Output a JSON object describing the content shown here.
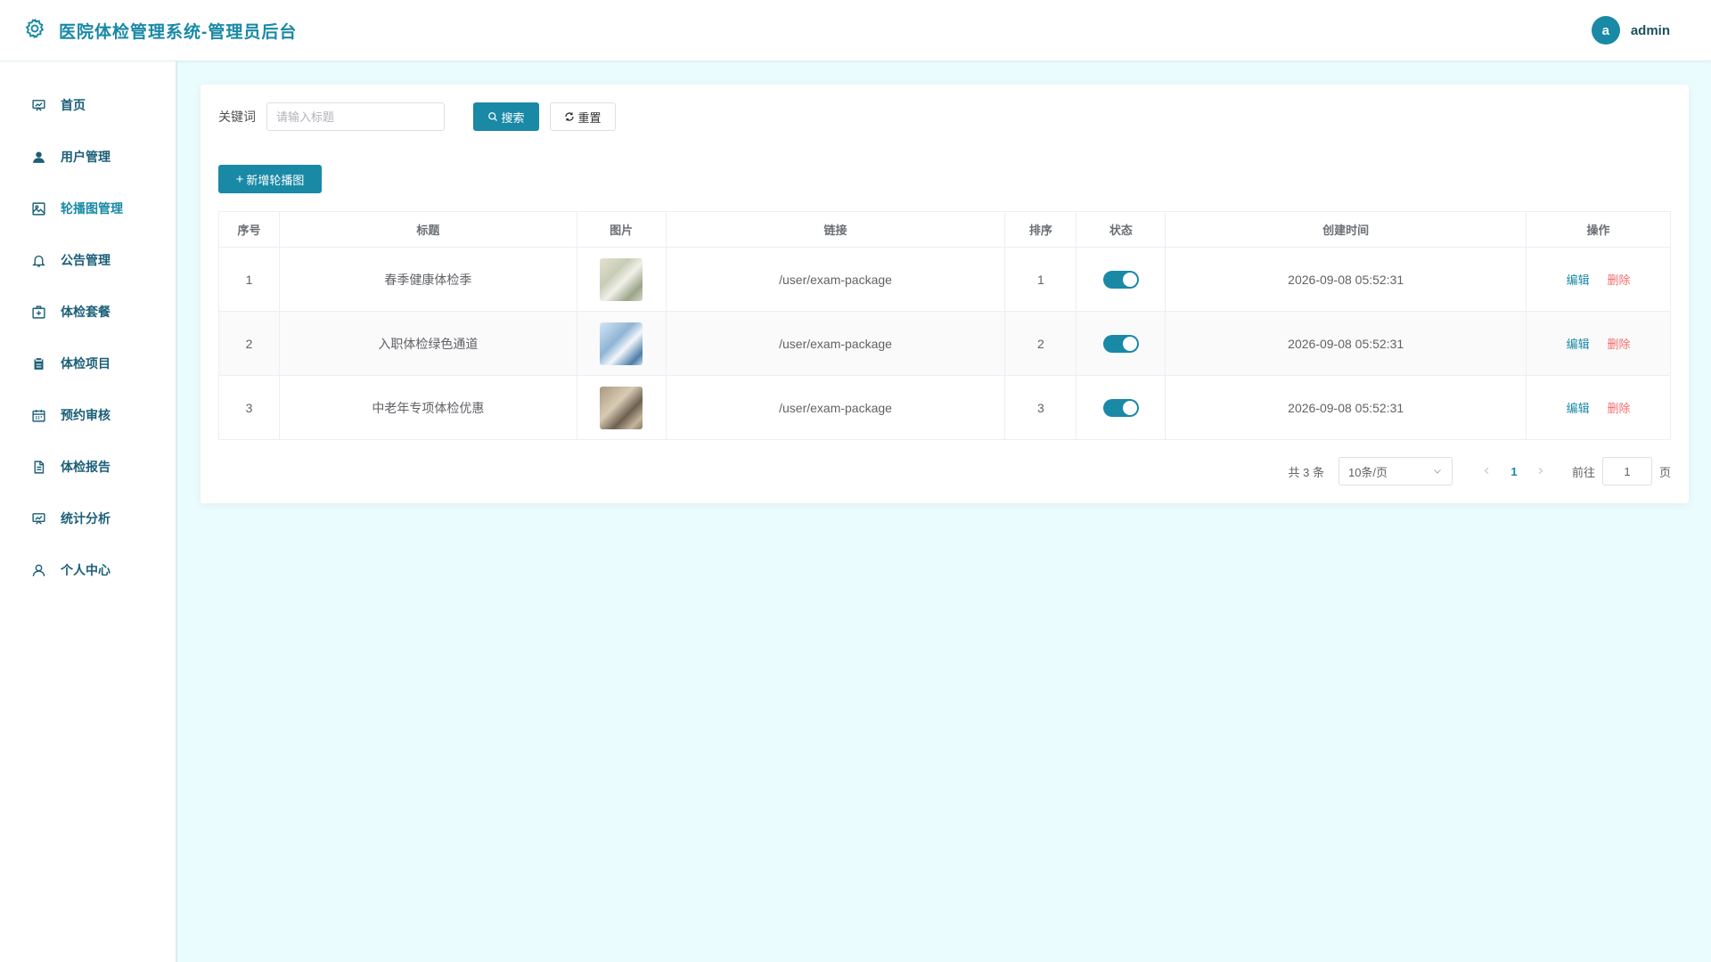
{
  "header": {
    "title": "医院体检管理系统-管理员后台",
    "avatar_letter": "a",
    "username": "admin"
  },
  "sidebar": {
    "items": [
      {
        "label": "首页",
        "icon": "dashboard-icon"
      },
      {
        "label": "用户管理",
        "icon": "user-icon"
      },
      {
        "label": "轮播图管理",
        "icon": "image-icon"
      },
      {
        "label": "公告管理",
        "icon": "bell-icon"
      },
      {
        "label": "体检套餐",
        "icon": "medical-box-icon"
      },
      {
        "label": "体检项目",
        "icon": "clipboard-icon"
      },
      {
        "label": "预约审核",
        "icon": "calendar-icon"
      },
      {
        "label": "体检报告",
        "icon": "document-icon"
      },
      {
        "label": "统计分析",
        "icon": "chart-board-icon"
      },
      {
        "label": "个人中心",
        "icon": "person-icon"
      }
    ],
    "active_index": 2
  },
  "search": {
    "label": "关键词",
    "placeholder": "请输入标题",
    "search_button": "搜索",
    "reset_button": "重置"
  },
  "toolbar": {
    "add_button": "新增轮播图"
  },
  "table": {
    "columns": [
      "序号",
      "标题",
      "图片",
      "链接",
      "排序",
      "状态",
      "创建时间",
      "操作"
    ],
    "rows": [
      {
        "index": "1",
        "title": "春季健康体检季",
        "link": "/user/exam-package",
        "sort": "1",
        "status": true,
        "created": "2026-09-08 05:52:31"
      },
      {
        "index": "2",
        "title": "入职体检绿色通道",
        "link": "/user/exam-package",
        "sort": "2",
        "status": true,
        "created": "2026-09-08 05:52:31"
      },
      {
        "index": "3",
        "title": "中老年专项体检优惠",
        "link": "/user/exam-package",
        "sort": "3",
        "status": true,
        "created": "2026-09-08 05:52:31"
      }
    ],
    "edit_label": "编辑",
    "delete_label": "删除"
  },
  "pagination": {
    "total_text": "共 3 条",
    "page_size": "10条/页",
    "current_page": "1",
    "goto_label": "前往",
    "goto_value": "1",
    "page_suffix": "页"
  },
  "colors": {
    "accent": "#1989a6",
    "danger": "#f56c6c",
    "background": "#eafcfd"
  }
}
